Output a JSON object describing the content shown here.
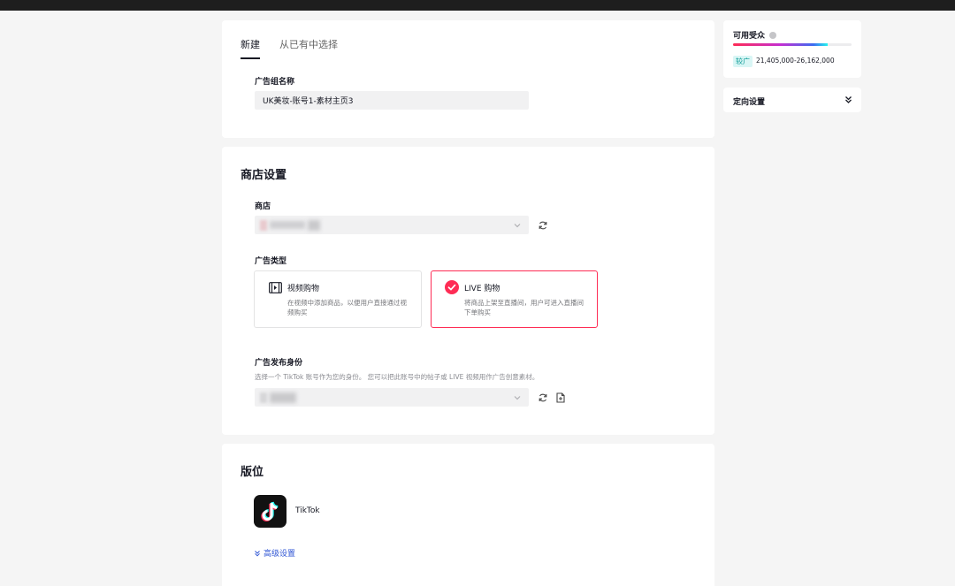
{
  "adgroup": {
    "tabs": [
      {
        "label": "新建",
        "active": true
      },
      {
        "label": "从已有中选择",
        "active": false
      }
    ],
    "name_label": "广告组名称",
    "name_value": "UK美妆-账号1-素材主页3"
  },
  "shop_settings": {
    "title": "商店设置",
    "shop_label": "商店",
    "ad_type_label": "广告类型",
    "ad_types": [
      {
        "title": "视频购物",
        "desc": "在视频中添加商品，以便用户直接通过视频购买",
        "icon": "video-shopping-icon",
        "selected": false
      },
      {
        "title": "LIVE 购物",
        "desc": "将商品上架至直播间，用户可进入直播间下单购买",
        "icon": "check-icon",
        "selected": true
      }
    ],
    "identity_label": "广告发布身份",
    "identity_helper": "选择一个 TikTok 账号作为您的身份。 您可以把此账号中的帖子或 LIVE 视频用作广告创意素材。"
  },
  "placement": {
    "title": "版位",
    "platform_name": "TikTok",
    "advanced_link": "高级设置"
  },
  "audience": {
    "title": "可用受众",
    "fill_fraction": 0.8,
    "tag": "较广",
    "range": "21,405,000-26,162,000"
  },
  "targeting": {
    "title": "定向设置"
  },
  "colors": {
    "accent": "#fe2c55",
    "link": "#2f55d4",
    "tag_text": "#0d9b97"
  }
}
